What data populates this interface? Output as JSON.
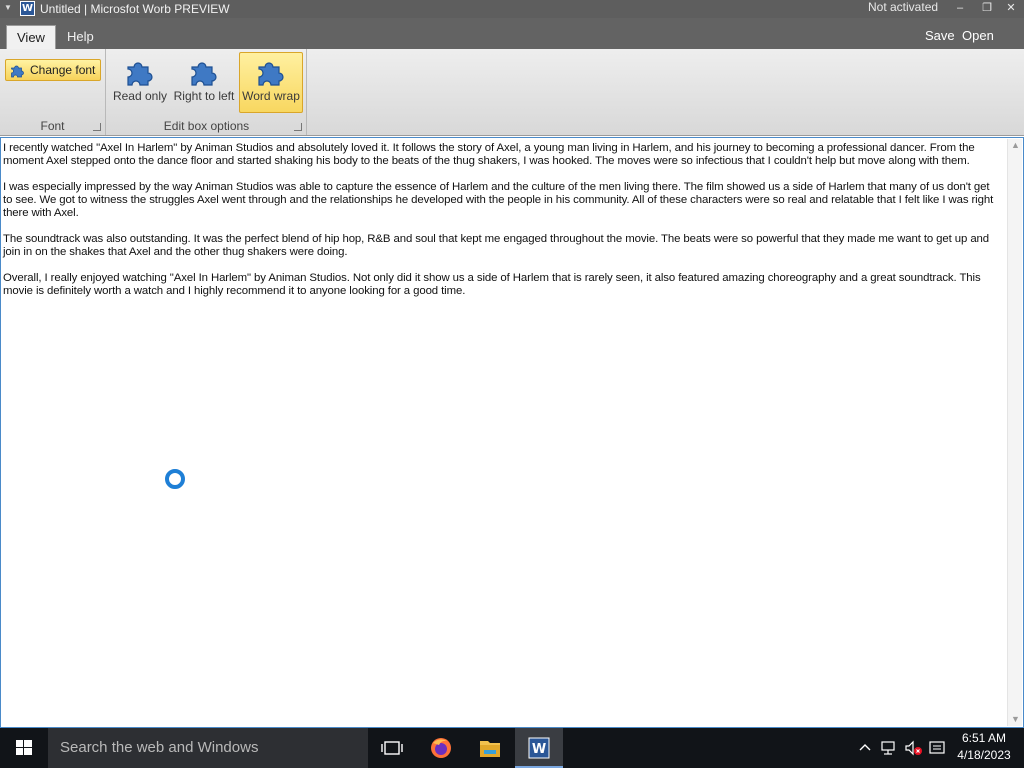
{
  "window": {
    "title": "Untitled | Microsfot Worb PREVIEW",
    "app_icon_letter": "W",
    "activation_status": "Not activated",
    "controls": {
      "minimize": "–",
      "restore": "❐",
      "close": "✕"
    }
  },
  "ribbon": {
    "tabs": [
      {
        "label": "View",
        "active": true
      },
      {
        "label": "Help",
        "active": false
      }
    ],
    "quick_actions": {
      "save": "Save",
      "open": "Open"
    },
    "groups": {
      "font": {
        "label": "Font",
        "change_font_label": "Change font"
      },
      "edit_box_options": {
        "label": "Edit box options",
        "read_only_label": "Read only",
        "right_to_left_label": "Right to left",
        "word_wrap_label": "Word wrap",
        "word_wrap_active": true
      }
    }
  },
  "document": {
    "paragraphs": [
      "I recently watched \"Axel In Harlem\" by Animan Studios and absolutely loved it. It follows the story of Axel, a young man living in Harlem, and his journey to becoming a professional dancer. From the moment Axel stepped onto the dance floor and started shaking his body to the beats of the thug shakers, I was hooked. The moves were so infectious that I couldn't help but move along with them.",
      "I was especially impressed by the way Animan Studios was able to capture the essence of Harlem and the culture of the men living there. The film showed us a side of Harlem that many of us don't get to see. We got to witness the struggles Axel went through and the relationships he developed with the people in his community. All of these characters were so real and relatable that I felt like I was right there with Axel.",
      "The soundtrack was also outstanding. It was the perfect blend of hip hop, R&B and soul that kept me engaged throughout the movie. The beats were so powerful that they made me want to get up and join in on the shakes that Axel and the other thug shakers were doing.",
      "Overall, I really enjoyed watching \"Axel In Harlem\" by Animan Studios. Not only did it show us a side of Harlem that is rarely seen, it also featured amazing choreography and a great soundtrack. This movie is definitely worth a watch and I highly recommend it to anyone looking for a good time."
    ]
  },
  "taskbar": {
    "search_placeholder": "Search the web and Windows",
    "clock_time": "6:51 AM",
    "clock_date": "4/18/2023",
    "pinned": [
      "task-view-icon",
      "firefox-icon",
      "file-explorer-icon",
      "worb-app-icon"
    ]
  },
  "colors": {
    "titlebar": "#5e5e5e",
    "ribbon_highlight": "#f8d760",
    "doc_border": "#4a8ac9",
    "spinner": "#1e7fd6",
    "taskbar": "#111418"
  }
}
